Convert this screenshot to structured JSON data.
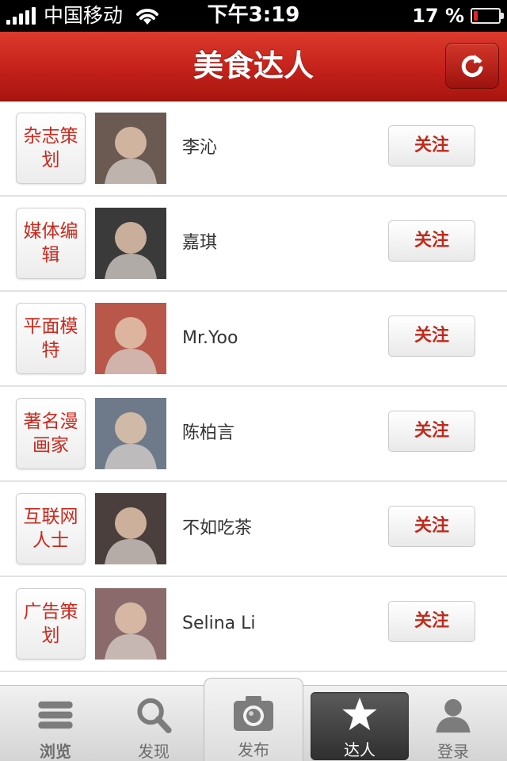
{
  "status_bar": {
    "carrier": "中国移动",
    "time": "下午3:19",
    "battery_percent": "17 %",
    "battery_level": 0.17
  },
  "nav": {
    "title": "美食达人",
    "refresh_icon": "refresh-icon"
  },
  "list": [
    {
      "tag": "杂志策划",
      "name": "李沁",
      "follow": "关注",
      "avatar_bg": "#6b5a52"
    },
    {
      "tag": "媒体编辑",
      "name": "嘉琪",
      "follow": "关注",
      "avatar_bg": "#3a3a3a"
    },
    {
      "tag": "平面模特",
      "name": "Mr.Yoo",
      "follow": "关注",
      "avatar_bg": "#b8574a"
    },
    {
      "tag": "著名漫画家",
      "name": "陈柏言",
      "follow": "关注",
      "avatar_bg": "#6e7a8a"
    },
    {
      "tag": "互联网人士",
      "name": "不如吃茶",
      "follow": "关注",
      "avatar_bg": "#4a3f3c"
    },
    {
      "tag": "广告策划",
      "name": "Selina Li",
      "follow": "关注",
      "avatar_bg": "#8a6a6a"
    }
  ],
  "tabs": [
    {
      "label": "浏览",
      "icon": "browse-icon"
    },
    {
      "label": "发现",
      "icon": "search-icon"
    },
    {
      "label": "发布",
      "icon": "camera-icon"
    },
    {
      "label": "达人",
      "icon": "star-icon",
      "active": true
    },
    {
      "label": "登录",
      "icon": "user-icon"
    }
  ],
  "colors": {
    "accent_red": "#c4211b",
    "tag_text": "#c92a1e",
    "follow_text": "#c02a1c"
  }
}
